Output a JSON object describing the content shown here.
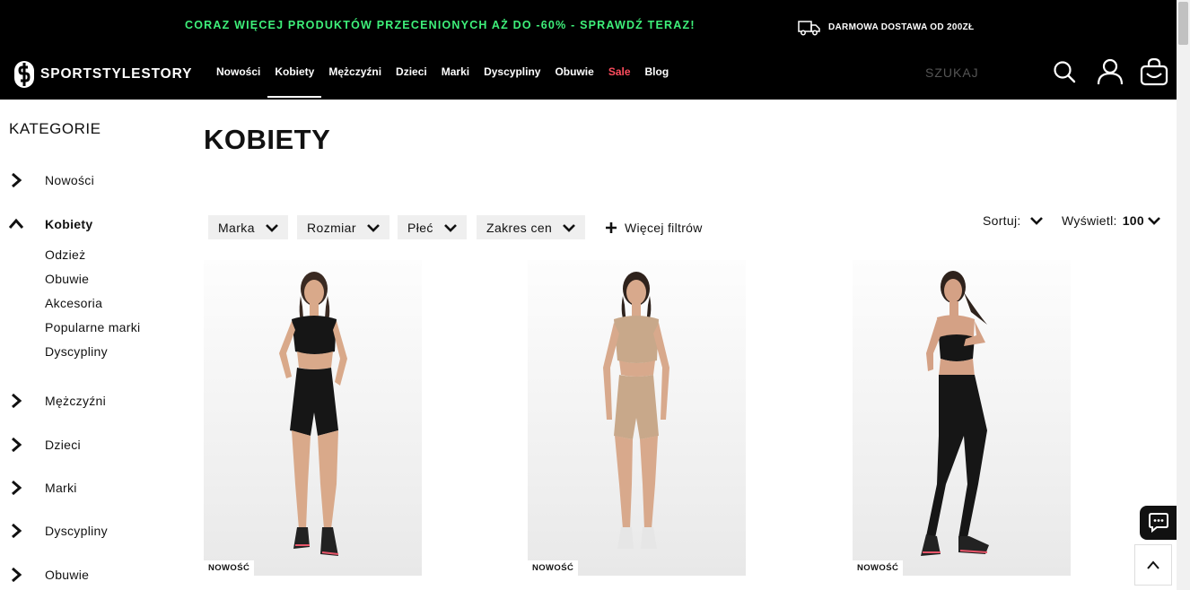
{
  "promo": {
    "text": "CORAZ WIĘCEJ PRODUKTÓW PRZECENIONYCH AŻ DO -60% - SPRAWDŹ TERAZ!",
    "shipping": "DARMOWA DOSTAWA OD 200ZŁ",
    "accent_color": "#3ef07a"
  },
  "header": {
    "logo_text": "SPORTSTYLESTORY",
    "nav": [
      {
        "label": "Nowości"
      },
      {
        "label": "Kobiety",
        "active": true
      },
      {
        "label": "Mężczyźni"
      },
      {
        "label": "Dzieci"
      },
      {
        "label": "Marki"
      },
      {
        "label": "Dyscypliny"
      },
      {
        "label": "Obuwie"
      },
      {
        "label": "Sale"
      },
      {
        "label": "Blog"
      }
    ],
    "sale_color": "#ff4d5e",
    "search_placeholder": "SZUKAJ",
    "icons": [
      "search-icon",
      "user-icon",
      "cart-icon"
    ]
  },
  "sidebar": {
    "title": "KATEGORIE",
    "categories": [
      {
        "label": "Nowości",
        "expanded": false
      },
      {
        "label": "Kobiety",
        "expanded": true,
        "children": [
          "Odzież",
          "Obuwie",
          "Akcesoria",
          "Popularne marki",
          "Dyscypliny"
        ]
      },
      {
        "label": "Mężczyźni",
        "expanded": false
      },
      {
        "label": "Dzieci",
        "expanded": false
      },
      {
        "label": "Marki",
        "expanded": false
      },
      {
        "label": "Dyscypliny",
        "expanded": false
      },
      {
        "label": "Obuwie",
        "expanded": false
      }
    ]
  },
  "main": {
    "title": "KOBIETY",
    "filters": [
      "Marka",
      "Rozmiar",
      "Płeć",
      "Zakres cen"
    ],
    "more_filters": "Więcej filtrów",
    "sort_label": "Sortuj:",
    "show_label": "Wyświetl:",
    "show_value": "100",
    "products": [
      {
        "badge": "NOWOŚĆ",
        "image": "woman-black-crop-top-and-shorts"
      },
      {
        "badge": "NOWOŚĆ",
        "image": "woman-beige-crop-top-and-shorts"
      },
      {
        "badge": "NOWOŚĆ",
        "image": "woman-black-sports-bra-and-leggings"
      }
    ]
  },
  "floating": {
    "icons": [
      "chat-icon",
      "arrow-up-icon"
    ]
  }
}
